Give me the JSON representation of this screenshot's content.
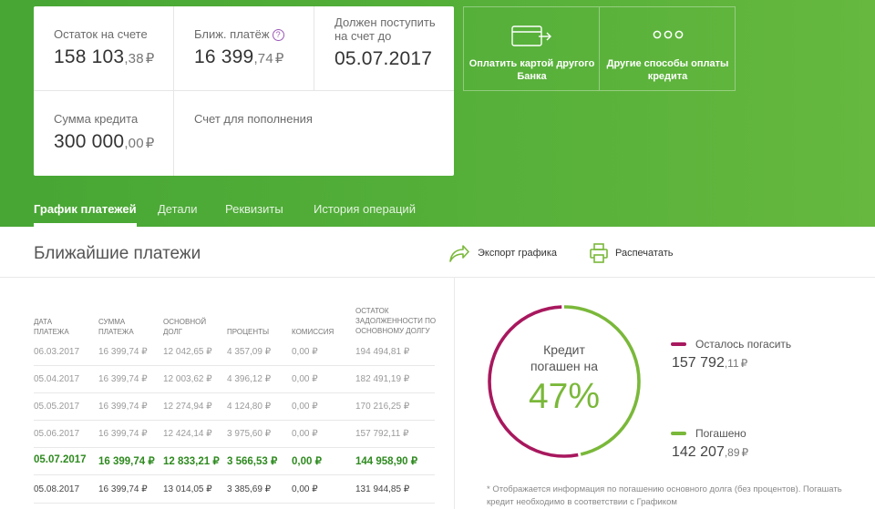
{
  "colors": {
    "green_dark": "#47a634",
    "remaining": "#a8185e",
    "paid": "#7ab83a"
  },
  "summary": {
    "balance": {
      "label": "Остаток на счете",
      "int": "158 103",
      "kop": ",38",
      "cur": "₽"
    },
    "next_payment": {
      "label": "Ближ. платёж",
      "int": "16 399",
      "kop": ",74",
      "cur": "₽"
    },
    "due": {
      "label": "Должен поступить на счет до",
      "value": "05.07.2017"
    },
    "loan_amount": {
      "label": "Сумма кредита",
      "int": "300 000",
      "kop": ",00",
      "cur": "₽"
    },
    "topup_account": {
      "label": "Счет для пополнения"
    }
  },
  "pay_options": {
    "other_bank_card": "Оплатить картой другого Банка",
    "other_ways": "Другие способы оплаты кредита"
  },
  "tabs": [
    {
      "label": "График платежей",
      "active": true
    },
    {
      "label": "Детали"
    },
    {
      "label": "Реквизиты"
    },
    {
      "label": "История операций"
    }
  ],
  "section": {
    "title": "Ближайшие платежи",
    "export": "Экспорт графика",
    "print": "Распечатать"
  },
  "table": {
    "headers": [
      "ДАТА ПЛАТЕЖА",
      "СУММА ПЛАТЕЖА",
      "ОСНОВНОЙ ДОЛГ",
      "ПРОЦЕНТЫ",
      "КОМИССИЯ",
      "ОСТАТОК ЗАДОЛЖЕННОСТИ ПО ОСНОВНОМУ ДОЛГУ"
    ],
    "rows": [
      [
        "06.03.2017",
        "16 399,74 ₽",
        "12 042,65 ₽",
        "4 357,09 ₽",
        "0,00 ₽",
        "194 494,81 ₽"
      ],
      [
        "05.04.2017",
        "16 399,74 ₽",
        "12 003,62 ₽",
        "4 396,12 ₽",
        "0,00 ₽",
        "182 491,19 ₽"
      ],
      [
        "05.05.2017",
        "16 399,74 ₽",
        "12 274,94 ₽",
        "4 124,80 ₽",
        "0,00 ₽",
        "170 216,25 ₽"
      ],
      [
        "05.06.2017",
        "16 399,74 ₽",
        "12 424,14 ₽",
        "3 975,60 ₽",
        "0,00 ₽",
        "157 792,11 ₽"
      ],
      [
        "05.07.2017",
        "16 399,74 ₽",
        "12 833,21 ₽",
        "3 566,53 ₽",
        "0,00 ₽",
        "144 958,90 ₽"
      ],
      [
        "05.08.2017",
        "16 399,74 ₽",
        "13 014,05 ₽",
        "3 385,69 ₽",
        "0,00 ₽",
        "131 944,85 ₽"
      ]
    ]
  },
  "progress": {
    "line1": "Кредит",
    "line2": "погашен на",
    "percent_label": "47%",
    "paid_fraction": 0.47
  },
  "legend": {
    "remaining": {
      "label": "Осталось погасить",
      "int": "157 792",
      "kop": ",11",
      "cur": "₽"
    },
    "paid": {
      "label": "Погашено",
      "int": "142 207",
      "kop": ",89",
      "cur": "₽"
    }
  },
  "footnote": "* Отображается информация по погашению основного долга (без процентов). Погашать кредит необходимо в соответствии с Графиком"
}
